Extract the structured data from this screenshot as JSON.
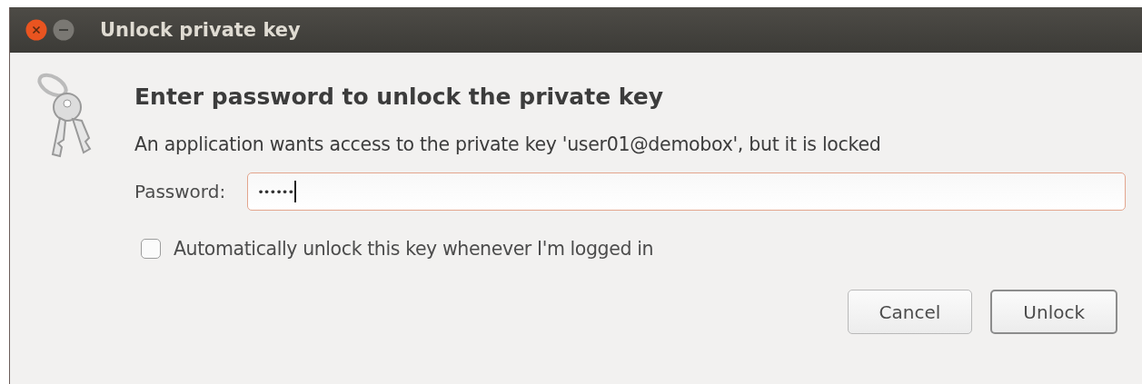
{
  "window": {
    "title": "Unlock private key"
  },
  "heading": "Enter password to unlock the private key",
  "message": "An application wants access to the private key 'user01@demobox', but it is locked",
  "password": {
    "label": "Password:",
    "value": "••••••"
  },
  "auto_unlock": {
    "label": "Automatically unlock this key whenever I'm logged in",
    "checked": false
  },
  "buttons": [
    {
      "label": "Cancel",
      "default": false
    },
    {
      "label": "Unlock",
      "default": true
    }
  ]
}
